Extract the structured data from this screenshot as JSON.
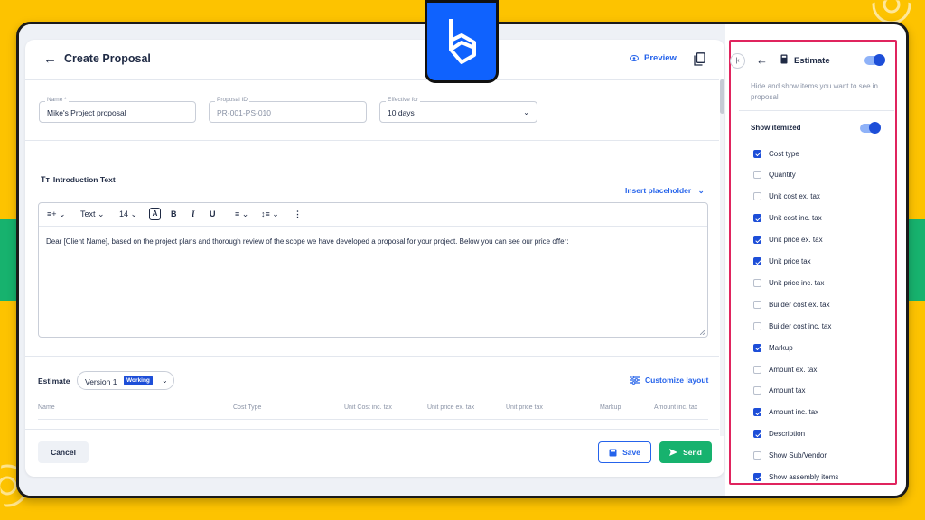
{
  "header": {
    "back_glyph": "←",
    "title": "Create Proposal",
    "preview_label": "Preview",
    "copy_icon": "copy-icon"
  },
  "fields": {
    "name": {
      "label": "Name *",
      "value": "Mike's Project proposal"
    },
    "proposal_id": {
      "label": "Proposal ID",
      "value": "PR-001-PS-010"
    },
    "effective_for": {
      "label": "Effective for",
      "value": "10 days"
    }
  },
  "intro": {
    "title": "Introduction Text",
    "insert_placeholder": "Insert placeholder",
    "toolbar": {
      "style": "Text",
      "size": "14",
      "bold": "B",
      "italic": "I",
      "underline": "U",
      "more": "⋮"
    },
    "body": "Dear [Client Name], based on the project plans and thorough review of the scope we have developed a proposal for your project. Below you can see our price offer:"
  },
  "estimate": {
    "label": "Estimate",
    "version": "Version 1",
    "version_badge": "Working",
    "customize_layout": "Customize layout",
    "columns": [
      "Name",
      "Cost Type",
      "Unit Cost inc. tax",
      "Unit price ex. tax",
      "Unit price tax",
      "Markup",
      "Amount inc. tax"
    ]
  },
  "footer": {
    "cancel": "Cancel",
    "save": "Save",
    "send": "Send"
  },
  "sidebar": {
    "title": "Estimate",
    "enabled": true,
    "description": "Hide and show items you want to see in proposal",
    "show_itemized_label": "Show itemized",
    "show_itemized": true,
    "items": [
      {
        "label": "Cost type",
        "checked": true
      },
      {
        "label": "Quantity",
        "checked": false
      },
      {
        "label": "Unit cost ex. tax",
        "checked": false
      },
      {
        "label": "Unit cost inc. tax",
        "checked": true
      },
      {
        "label": "Unit price ex. tax",
        "checked": true
      },
      {
        "label": "Unit price tax",
        "checked": true
      },
      {
        "label": "Unit price inc. tax",
        "checked": false
      },
      {
        "label": "Builder cost ex. tax",
        "checked": false
      },
      {
        "label": "Builder cost inc. tax",
        "checked": false
      },
      {
        "label": "Markup",
        "checked": true
      },
      {
        "label": "Amount ex. tax",
        "checked": false
      },
      {
        "label": "Amount tax",
        "checked": false
      },
      {
        "label": "Amount inc. tax",
        "checked": true
      },
      {
        "label": "Description",
        "checked": true
      },
      {
        "label": "Show Sub/Vendor",
        "checked": false
      },
      {
        "label": "Show assembly items",
        "checked": true
      }
    ]
  },
  "colors": {
    "background": "#FDC300",
    "band": "#17B26E",
    "accent": "#2563eb",
    "send": "#17B26E",
    "highlight_border": "#E0245E"
  }
}
